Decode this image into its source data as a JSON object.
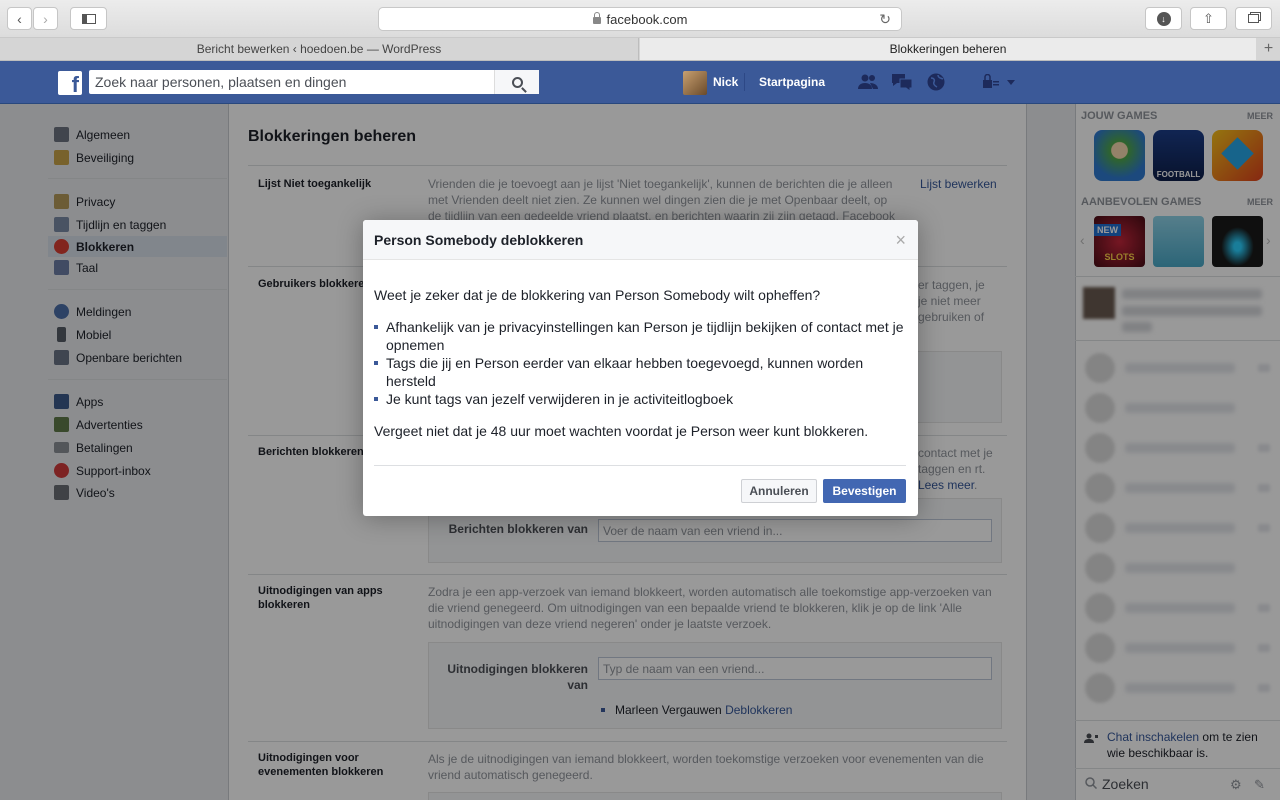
{
  "browser": {
    "url": "facebook.com",
    "tabs": [
      {
        "label": "Bericht bewerken ‹ hoedoen.be — WordPress"
      },
      {
        "label": "Blokkeringen beheren"
      }
    ]
  },
  "topbar": {
    "search_placeholder": "Zoek naar personen, plaatsen en dingen",
    "user_name": "Nick",
    "home_label": "Startpagina"
  },
  "leftnav": {
    "items": [
      {
        "label": "Algemeen",
        "icon": "gears-icon",
        "color": "#6d7480"
      },
      {
        "label": "Beveiliging",
        "icon": "shield-icon",
        "color": "#c9a44a"
      },
      {
        "label": "Privacy",
        "icon": "lock-icon",
        "color": "#b59a5a"
      },
      {
        "label": "Tijdlijn en taggen",
        "icon": "timeline-icon",
        "color": "#7b8aa6"
      },
      {
        "label": "Blokkeren",
        "icon": "block-icon",
        "color": "#d93f33"
      },
      {
        "label": "Taal",
        "icon": "language-icon",
        "color": "#6d7ea6"
      },
      {
        "label": "Meldingen",
        "icon": "globe-icon",
        "color": "#4c6ea8"
      },
      {
        "label": "Mobiel",
        "icon": "mobile-icon",
        "color": "#555c66"
      },
      {
        "label": "Openbare berichten",
        "icon": "rss-icon",
        "color": "#6a7486"
      },
      {
        "label": "Apps",
        "icon": "apps-icon",
        "color": "#3d5a8a"
      },
      {
        "label": "Advertenties",
        "icon": "ads-icon",
        "color": "#5f7a4a"
      },
      {
        "label": "Betalingen",
        "icon": "card-icon",
        "color": "#8a8f96"
      },
      {
        "label": "Support-inbox",
        "icon": "lifebuoy-icon",
        "color": "#d13b3b"
      },
      {
        "label": "Video's",
        "icon": "film-icon",
        "color": "#6b6f76"
      }
    ]
  },
  "main": {
    "title": "Blokkeringen beheren",
    "sections": {
      "restricted": {
        "heading": "Lijst Niet toegankelijk",
        "desc": "Vrienden die je toevoegt aan je lijst 'Niet toegankelijk', kunnen de berichten die je alleen met Vrienden deelt niet zien. Ze kunnen wel dingen zien die je met Openbaar deelt, op de tijdlijn van een gedeelde vriend plaatst, en berichten waarin zij zijn getagd. Facebook laat niet",
        "action": "Lijst bewerken"
      },
      "block_users": {
        "heading": "Gebruikers blokkeren",
        "desc_right": "er taggen, je je niet meer gebruiken of"
      },
      "block_messages": {
        "heading": "Berichten blokkeren",
        "desc_right": "contact met je taggen en rt.",
        "more_link": "Lees meer",
        "field_label": "Berichten blokkeren van",
        "field_placeholder": "Voer de naam van een vriend in..."
      },
      "block_app_invites": {
        "heading": "Uitnodigingen van apps blokkeren",
        "desc": "Zodra je een app-verzoek van iemand blokkeert, worden automatisch alle toekomstige app-verzoeken van die vriend genegeerd. Om uitnodigingen van een bepaalde vriend te blokkeren, klik je op de link 'Alle uitnodigingen van deze vriend negeren' onder je laatste verzoek.",
        "field_label": "Uitnodigingen blokkeren van",
        "field_placeholder": "Typ de naam van een vriend...",
        "blocked_name": "Marleen Vergauwen",
        "unblock_link": "Deblokkeren"
      },
      "block_event_invites": {
        "heading": "Uitnodigingen voor evenementen blokkeren",
        "desc": "Als je de uitnodigingen van iemand blokkeert, worden toekomstige verzoeken voor evenementen van die vriend automatisch genegeerd."
      }
    }
  },
  "rightbar": {
    "your_games": "JOUW GAMES",
    "more1": "MEER",
    "recommended": "AANBEVOLEN GAMES",
    "more2": "MEER",
    "new_badge": "NEW",
    "slots_label": "SLOTS",
    "football_label": "FOOTBALL",
    "chat_link": "Chat inschakelen",
    "chat_text": "om te zien wie beschikbaar is.",
    "chat_search": "Zoeken"
  },
  "dialog": {
    "title": "Person Somebody deblokkeren",
    "question": "Weet je zeker dat je de blokkering van Person Somebody wilt opheffen?",
    "bullets": [
      "Afhankelijk van je privacyinstellingen kan Person je tijdlijn bekijken of contact met je opnemen",
      "Tags die jij en Person eerder van elkaar hebben toegevoegd, kunnen worden hersteld",
      "Je kunt tags van jezelf verwijderen in je activiteitlogboek"
    ],
    "note": "Vergeet niet dat je 48 uur moet wachten voordat je Person weer kunt blokkeren.",
    "cancel_label": "Annuleren",
    "confirm_label": "Bevestigen"
  }
}
